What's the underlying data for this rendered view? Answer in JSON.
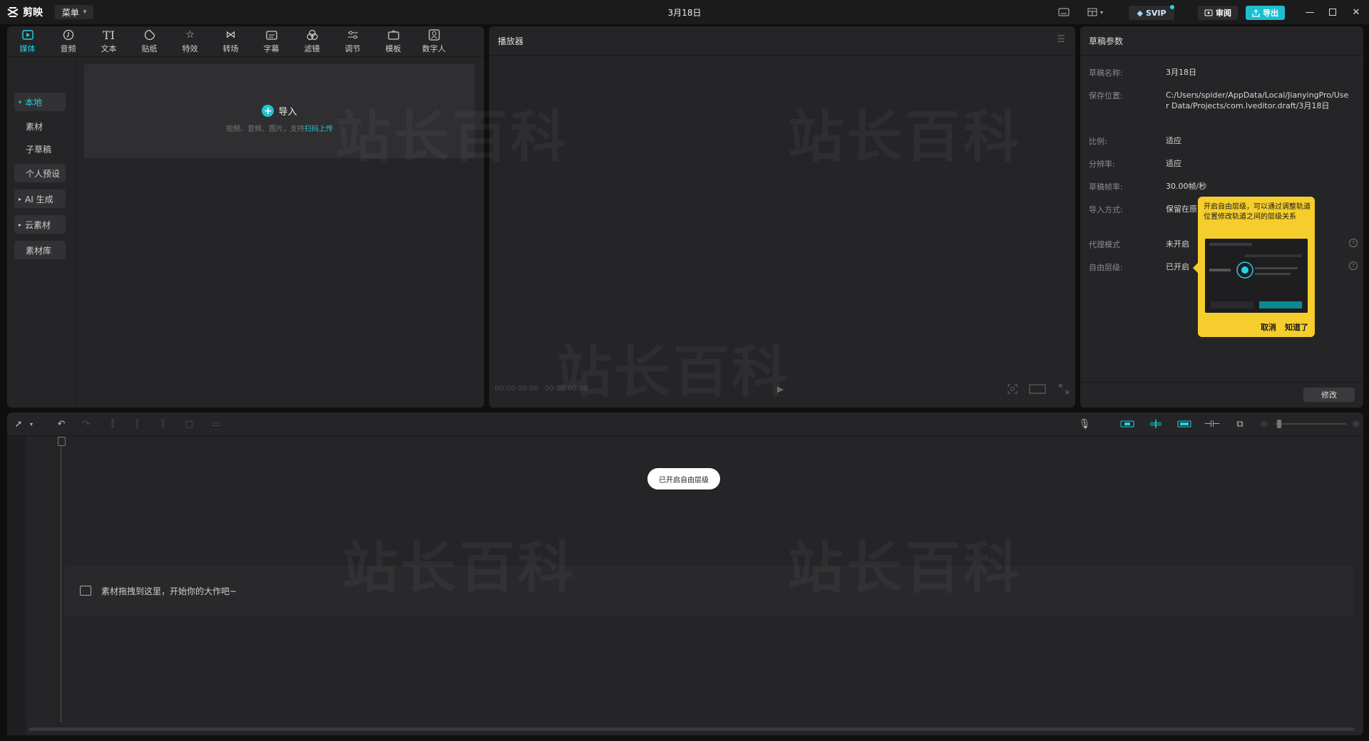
{
  "app": {
    "name": "剪映",
    "menu_label": "菜单",
    "title": "3月18日",
    "svip_label": "SVIP",
    "review_label": "审阅",
    "export_label": "导出",
    "accent": "#22d3e6"
  },
  "media_tabs": [
    {
      "label": "媒体",
      "icon": "media-icon"
    },
    {
      "label": "音频",
      "icon": "audio-icon"
    },
    {
      "label": "文本",
      "icon": "text-icon"
    },
    {
      "label": "贴纸",
      "icon": "sticker-icon"
    },
    {
      "label": "特效",
      "icon": "effects-icon"
    },
    {
      "label": "转场",
      "icon": "transition-icon"
    },
    {
      "label": "字幕",
      "icon": "subtitle-icon"
    },
    {
      "label": "滤镜",
      "icon": "filter-icon"
    },
    {
      "label": "调节",
      "icon": "adjust-icon"
    },
    {
      "label": "模板",
      "icon": "template-icon"
    },
    {
      "label": "数字人",
      "icon": "digital-human-icon"
    }
  ],
  "media_sidebar": [
    {
      "label": "本地"
    },
    {
      "label": "素材"
    },
    {
      "label": "子草稿"
    },
    {
      "label": "个人预设"
    },
    {
      "label": "AI 生成"
    },
    {
      "label": "云素材"
    },
    {
      "label": "素材库"
    }
  ],
  "import": {
    "label": "导入",
    "hint": "视频、音频、图片，支持",
    "link": "扫码上传"
  },
  "player": {
    "title": "播放器",
    "timecode_current": "00:00:00:00",
    "timecode_total": "00:00:00:00"
  },
  "params": {
    "title": "草稿参数",
    "rows": [
      {
        "label": "草稿名称:",
        "value": "3月18日"
      },
      {
        "label": "保存位置:",
        "value": "C:/Users/spider/AppData/Local/JianyingPro/User Data/Projects/com.lveditor.draft/3月18日"
      },
      {
        "label": "比例:",
        "value": "适应"
      },
      {
        "label": "分辨率:",
        "value": "适应"
      },
      {
        "label": "草稿帧率:",
        "value": "30.00帧/秒"
      },
      {
        "label": "导入方式:",
        "value": "保留在原"
      },
      {
        "label": "代理模式",
        "value": "未开启"
      },
      {
        "label": "自由层级:",
        "value": "已开启"
      }
    ],
    "modify_label": "修改"
  },
  "tooltip": {
    "text": "开启自由层级，可以通过调整轨道位置修改轨道之间的层级关系",
    "cancel_label": "取消",
    "ok_label": "知道了"
  },
  "timeline": {
    "toast": "已开启自由层级",
    "drop_hint": "素材拖拽到这里，开始你的大作吧~"
  },
  "watermark": "站长百科"
}
